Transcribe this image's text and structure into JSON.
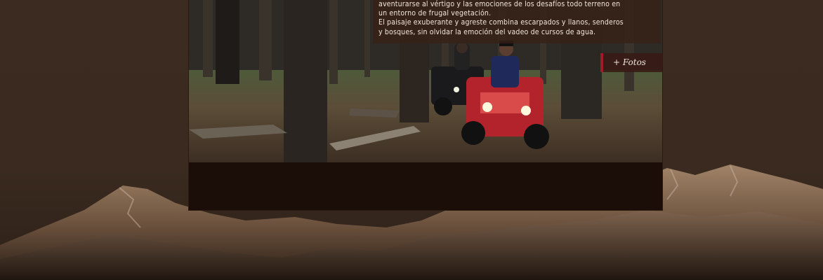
{
  "article": {
    "line1": "aventurarse al vértigo y las emociones de los desafíos todo terreno en",
    "line2": "un entorno de frugal vegetación.",
    "line3": "El paisaje exuberante y agreste combina escarpados y llanos, senderos",
    "line4": "y bosques, sin olvidar la emoción del vadeo de cursos de agua."
  },
  "gallery": {
    "fotos_label": "+ Fotos"
  },
  "photo": {
    "subject": "two riders on quad bikes in a forest"
  },
  "colors": {
    "accent": "#a3192a",
    "panel": "#1b0f0a",
    "backdrop": "#3a2a1f"
  }
}
